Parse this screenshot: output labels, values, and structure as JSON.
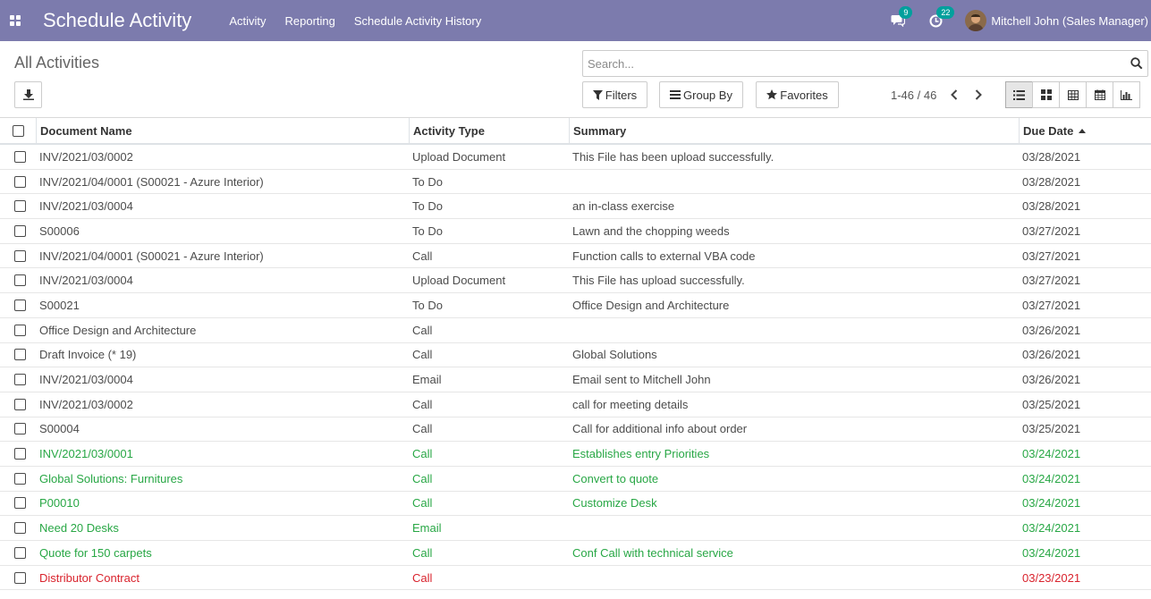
{
  "navbar": {
    "app_title": "Schedule Activity",
    "menu": [
      "Activity",
      "Reporting",
      "Schedule Activity History"
    ],
    "messages_count": "9",
    "activities_count": "22",
    "user_name": "Mitchell John (Sales Manager)",
    "color": "#7c7bad"
  },
  "control_panel": {
    "breadcrumb": "All Activities",
    "search_placeholder": "Search...",
    "filters_label": "Filters",
    "groupby_label": "Group By",
    "favorites_label": "Favorites",
    "pager": "1-46 / 46"
  },
  "table": {
    "headers": {
      "document_name": "Document Name",
      "activity_type": "Activity Type",
      "summary": "Summary",
      "due_date": "Due Date"
    },
    "rows": [
      {
        "doc": "INV/2021/03/0002",
        "type": "Upload Document",
        "summary": "This File has been upload successfully.",
        "due": "03/28/2021",
        "status": "normal"
      },
      {
        "doc": "INV/2021/04/0001 (S00021 - Azure Interior)",
        "type": "To Do",
        "summary": "",
        "due": "03/28/2021",
        "status": "normal"
      },
      {
        "doc": "INV/2021/03/0004",
        "type": "To Do",
        "summary": "an in-class exercise",
        "due": "03/28/2021",
        "status": "normal"
      },
      {
        "doc": "S00006",
        "type": "To Do",
        "summary": "Lawn and the chopping weeds",
        "due": "03/27/2021",
        "status": "normal"
      },
      {
        "doc": "INV/2021/04/0001 (S00021 - Azure Interior)",
        "type": "Call",
        "summary": "Function calls to external VBA code",
        "due": "03/27/2021",
        "status": "normal"
      },
      {
        "doc": "INV/2021/03/0004",
        "type": "Upload Document",
        "summary": "This File has upload successfully.",
        "due": "03/27/2021",
        "status": "normal"
      },
      {
        "doc": "S00021",
        "type": "To Do",
        "summary": "Office Design and Architecture",
        "due": "03/27/2021",
        "status": "normal"
      },
      {
        "doc": "Office Design and Architecture",
        "type": "Call",
        "summary": "",
        "due": "03/26/2021",
        "status": "normal"
      },
      {
        "doc": "Draft Invoice (* 19)",
        "type": "Call",
        "summary": "Global Solutions",
        "due": "03/26/2021",
        "status": "normal"
      },
      {
        "doc": "INV/2021/03/0004",
        "type": "Email",
        "summary": "Email sent to Mitchell John",
        "due": "03/26/2021",
        "status": "normal"
      },
      {
        "doc": "INV/2021/03/0002",
        "type": "Call",
        "summary": "call for meeting details",
        "due": "03/25/2021",
        "status": "normal"
      },
      {
        "doc": "S00004",
        "type": "Call",
        "summary": "Call for additional info about order",
        "due": "03/25/2021",
        "status": "normal"
      },
      {
        "doc": "INV/2021/03/0001",
        "type": "Call",
        "summary": "Establishes entry Priorities",
        "due": "03/24/2021",
        "status": "green"
      },
      {
        "doc": "Global Solutions: Furnitures",
        "type": "Call",
        "summary": "Convert to quote",
        "due": "03/24/2021",
        "status": "green"
      },
      {
        "doc": "P00010",
        "type": "Call",
        "summary": "Customize Desk",
        "due": "03/24/2021",
        "status": "green"
      },
      {
        "doc": "Need 20 Desks",
        "type": "Email",
        "summary": "",
        "due": "03/24/2021",
        "status": "green"
      },
      {
        "doc": "Quote for 150 carpets",
        "type": "Call",
        "summary": "Conf Call with technical service",
        "due": "03/24/2021",
        "status": "green"
      },
      {
        "doc": "Distributor Contract",
        "type": "Call",
        "summary": "",
        "due": "03/23/2021",
        "status": "red"
      }
    ]
  }
}
